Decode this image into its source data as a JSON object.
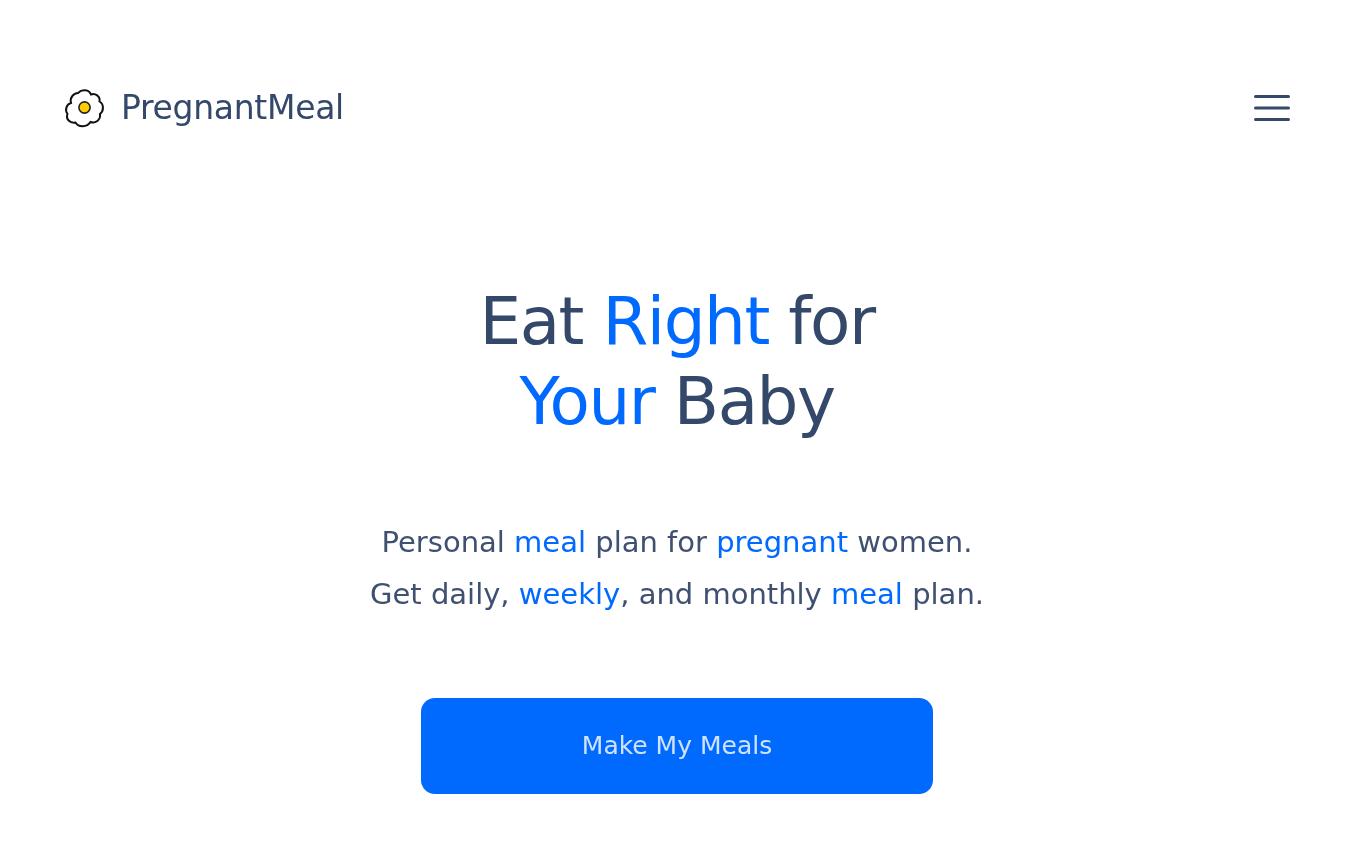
{
  "header": {
    "brand": "PregnantMeal"
  },
  "hero": {
    "headline": [
      [
        {
          "text": "Eat ",
          "highlighted": false
        },
        {
          "text": "Right",
          "highlighted": true
        },
        {
          "text": " for",
          "highlighted": false
        }
      ],
      [
        {
          "text": "Your",
          "highlighted": true
        },
        {
          "text": " Baby",
          "highlighted": false
        }
      ]
    ],
    "description": [
      [
        {
          "text": "Personal ",
          "highlighted": false
        },
        {
          "text": "meal",
          "highlighted": true
        },
        {
          "text": " plan for ",
          "highlighted": false
        },
        {
          "text": "pregnant",
          "highlighted": true
        },
        {
          "text": " women.",
          "highlighted": false
        }
      ],
      [
        {
          "text": "Get daily, ",
          "highlighted": false
        },
        {
          "text": "weekly",
          "highlighted": true
        },
        {
          "text": ", and monthly ",
          "highlighted": false
        },
        {
          "text": "meal",
          "highlighted": true
        },
        {
          "text": " plan.",
          "highlighted": false
        }
      ]
    ],
    "button": "Make My Meals"
  }
}
